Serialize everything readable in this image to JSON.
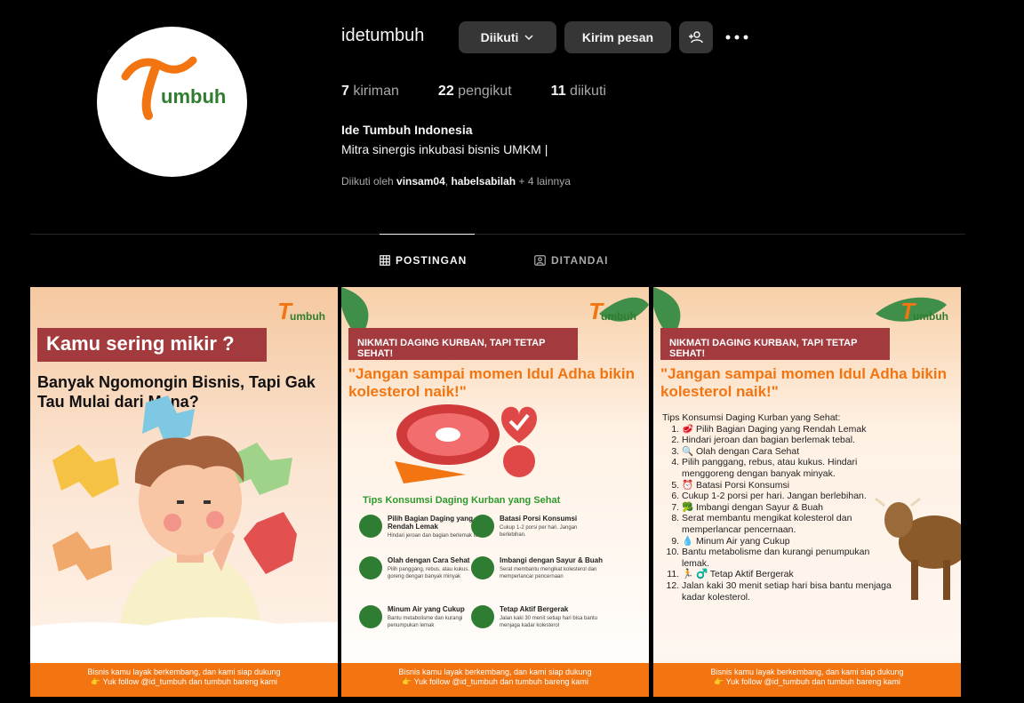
{
  "profile": {
    "username": "idetumbuh",
    "follow_label": "Diikuti",
    "message_label": "Kirim pesan",
    "logo_t": "T",
    "logo_rest": "umbuh",
    "stats": [
      {
        "count": "7",
        "label": "kiriman"
      },
      {
        "count": "22",
        "label": "pengikut"
      },
      {
        "count": "11",
        "label": "diikuti"
      }
    ],
    "full_name": "Ide Tumbuh Indonesia",
    "bio": "Mitra sinergis inkubasi bisnis UMKM |",
    "followed_by_prefix": "Diikuti oleh",
    "followed_by_user1": "vinsam04",
    "followed_by_sep": ",",
    "followed_by_user2": "habelsabilah",
    "followed_by_more": "+ 4 lainnya"
  },
  "tabs": [
    {
      "label": "POSTINGAN",
      "active": true
    },
    {
      "label": "DITANDAI",
      "active": false
    }
  ],
  "posts": {
    "footer_line1": "Bisnis kamu layak berkembang, dan kami siap dukung",
    "footer_line2": "👉 Yuk follow @id_tumbuh dan tumbuh bareng kami",
    "brand_t": "T",
    "brand_rest": "umbuh",
    "p1": {
      "banner": "Kamu sering mikir ?",
      "heading": "Banyak Ngomongin Bisnis, Tapi Gak Tau Mulai dari Mana?"
    },
    "p2": {
      "banner": "NIKMATI DAGING KURBAN, TAPI TETAP SEHAT!",
      "quote": "\"Jangan sampai momen Idul Adha bikin kolesterol naik!\"",
      "tips_title": "Tips Konsumsi Daging Kurban yang Sehat",
      "tips": [
        {
          "title": "Pilih Bagian Daging yang Rendah Lemak",
          "desc": "Hindari jeroan dan bagian berlemak tebal."
        },
        {
          "title": "Batasi Porsi Konsumsi",
          "desc": "Cukup 1-2 porsi per hari. Jangan berlebihan."
        },
        {
          "title": "Olah dengan Cara Sehat",
          "desc": "Pilih panggang, rebus, atau kukus. Hindari goreng dengan banyak minyak"
        },
        {
          "title": "Imbangi dengan Sayur & Buah",
          "desc": "Serat membantu mengikat kolesterol dan memperlancar pencernaan"
        },
        {
          "title": "Minum Air yang Cukup",
          "desc": "Bantu metabolisme dan kurangi penumpukan lemak"
        },
        {
          "title": "Tetap Aktif Bergerak",
          "desc": "Jalan kaki 30 menit setiap hari bisa bantu menjaga kadar kolesterol"
        }
      ]
    },
    "p3": {
      "banner": "NIKMATI DAGING KURBAN, TAPI TETAP SEHAT!",
      "quote": "\"Jangan sampai momen Idul Adha bikin kolesterol naik!\"",
      "list_title": "Tips Konsumsi Daging Kurban yang Sehat:",
      "items": [
        "🥩 Pilih Bagian Daging yang Rendah Lemak",
        "Hindari jeroan dan bagian berlemak tebal.",
        "🔍 Olah dengan Cara Sehat",
        "Pilih panggang, rebus, atau kukus. Hindari menggoreng dengan banyak minyak.",
        "⏰ Batasi Porsi Konsumsi",
        "Cukup 1-2 porsi per hari. Jangan berlebihan.",
        "🥦 Imbangi dengan Sayur & Buah",
        "Serat membantu mengikat kolesterol dan memperlancar pencernaan.",
        "💧 Minum Air yang Cukup",
        "Bantu metabolisme dan kurangi penumpukan lemak.",
        "🏃 ♂️ Tetap Aktif Bergerak",
        "Jalan kaki 30 menit setiap hari bisa bantu menjaga kadar kolesterol."
      ]
    }
  }
}
